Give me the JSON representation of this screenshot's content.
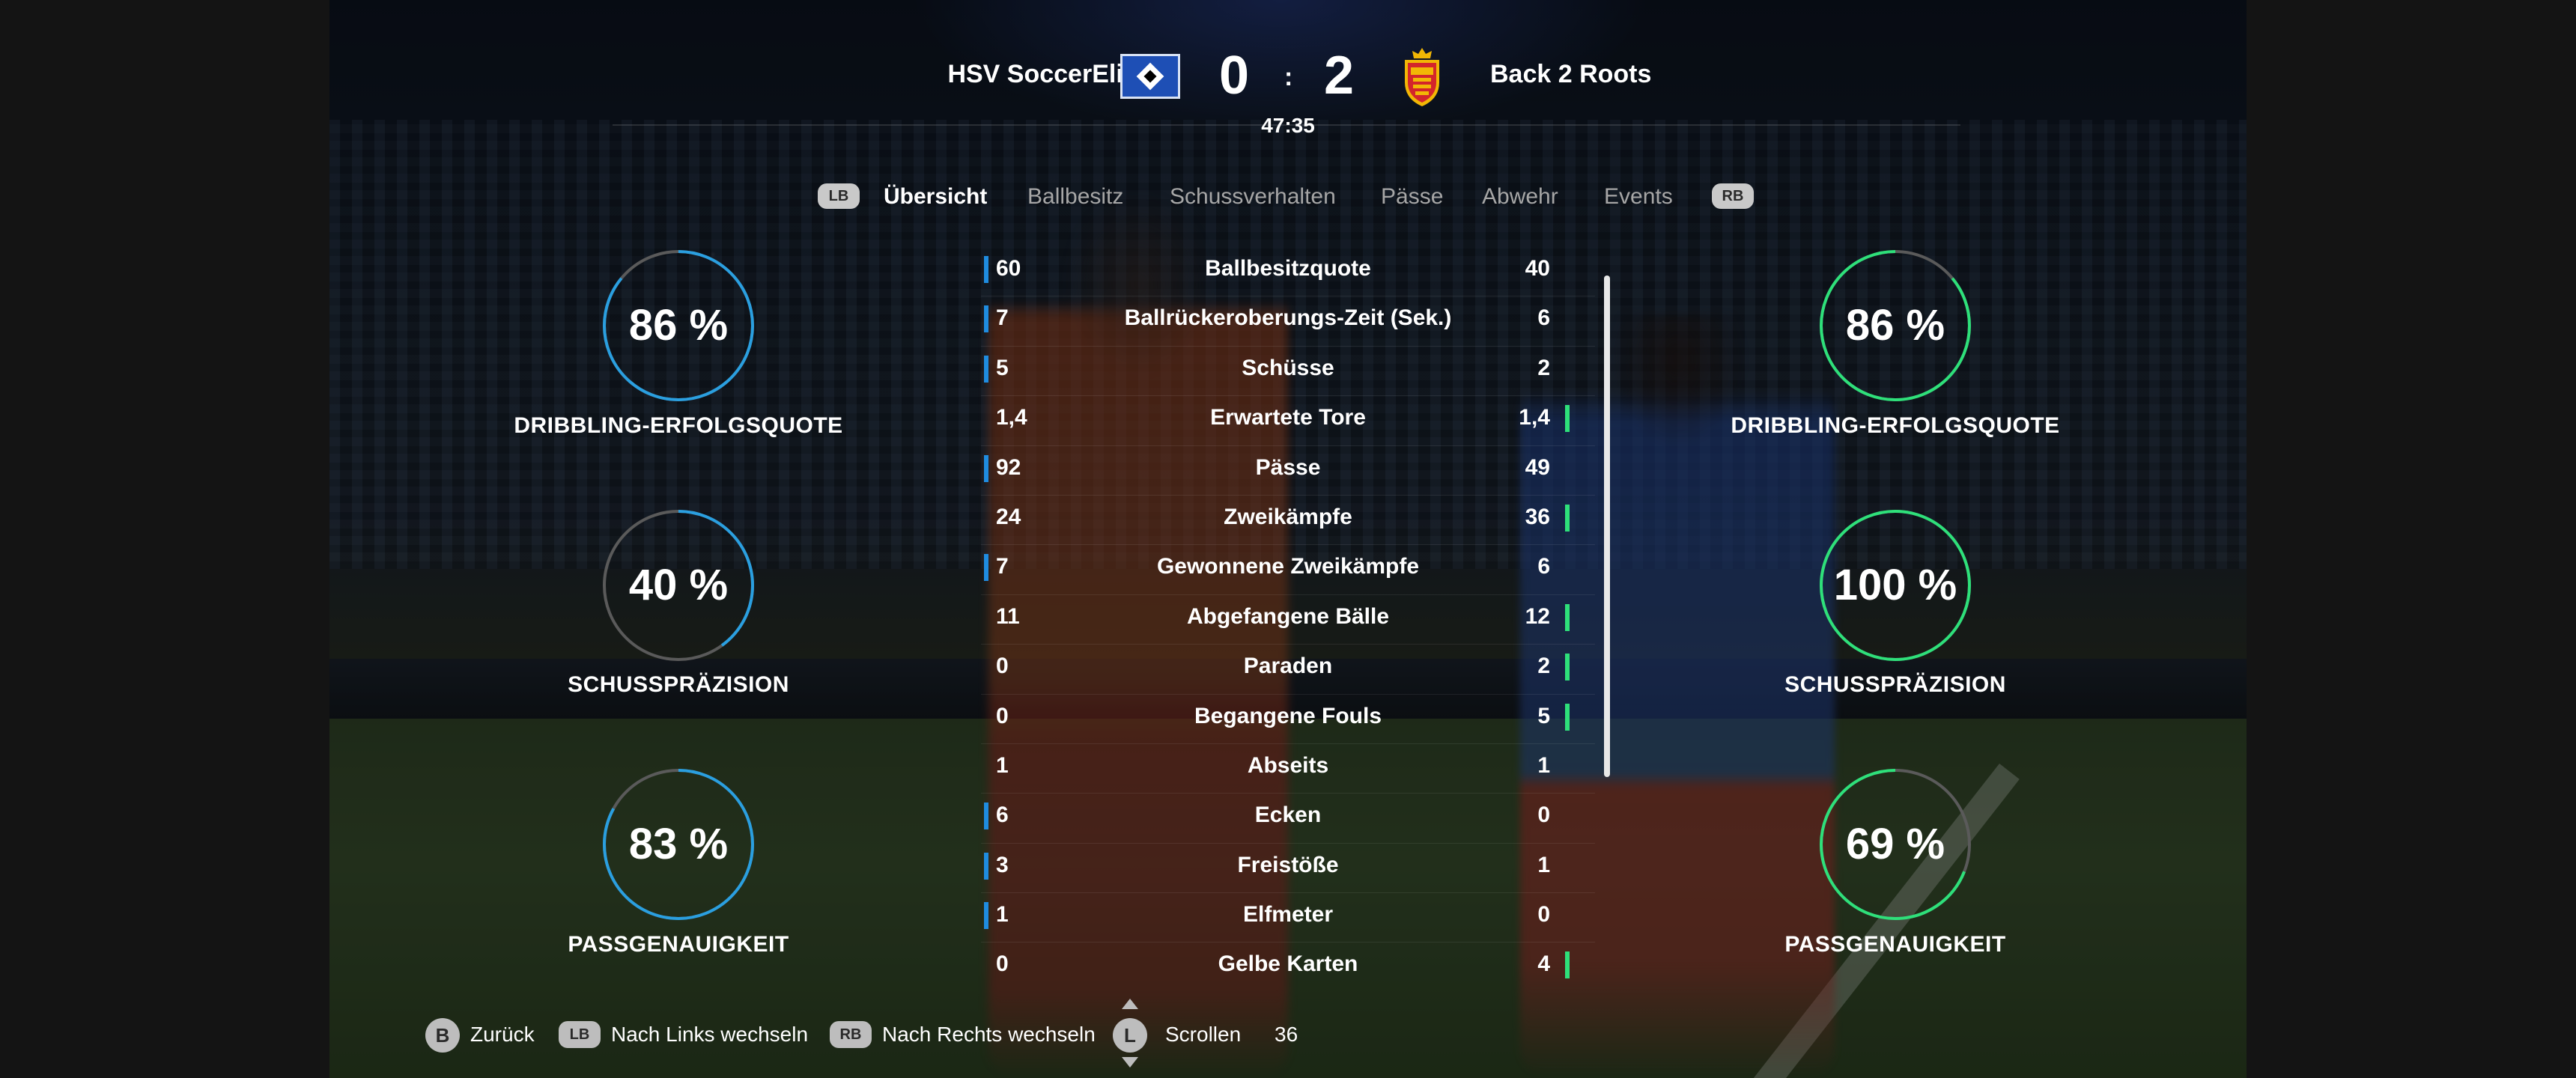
{
  "header": {
    "home_team": "HSV SoccerElite",
    "away_team": "Back 2 Roots",
    "home_score": "0",
    "away_score": "2",
    "separator": ":",
    "clock": "47:35",
    "home_crest_icon": "hsv-diamond-crest-icon",
    "away_crest_icon": "fcn-shield-crest-icon"
  },
  "tabs": {
    "left_bumper": "LB",
    "right_bumper": "RB",
    "items": [
      "Übersicht",
      "Ballbesitz",
      "Schussverhalten",
      "Pässe",
      "Abwehr",
      "Events"
    ],
    "active": "Übersicht"
  },
  "gauges": {
    "home": [
      {
        "value": "86 %",
        "fraction": 0.86,
        "label": "DRIBBLING-ERFOLGSQUOTE"
      },
      {
        "value": "40 %",
        "fraction": 0.4,
        "label": "SCHUSSPRÄZISION"
      },
      {
        "value": "83 %",
        "fraction": 0.83,
        "label": "PASSGENAUIGKEIT"
      }
    ],
    "away": [
      {
        "value": "86 %",
        "fraction": 0.86,
        "label": "DRIBBLING-ERFOLGSQUOTE"
      },
      {
        "value": "100 %",
        "fraction": 1.0,
        "label": "SCHUSSPRÄZISION"
      },
      {
        "value": "69 %",
        "fraction": 0.69,
        "label": "PASSGENAUIGKEIT"
      }
    ],
    "home_color": "#2a9fe0",
    "away_color": "#2ee07a",
    "track_color": "#5a5a5a"
  },
  "stats": [
    {
      "label": "Ballbesitzquote",
      "home": "60",
      "away": "40",
      "lead": "home"
    },
    {
      "label": "Ballrückeroberungs-Zeit (Sek.)",
      "home": "7",
      "away": "6",
      "lead": "home"
    },
    {
      "label": "Schüsse",
      "home": "5",
      "away": "2",
      "lead": "home"
    },
    {
      "label": "Erwartete Tore",
      "home": "1,4",
      "away": "1,4",
      "lead": "away"
    },
    {
      "label": "Pässe",
      "home": "92",
      "away": "49",
      "lead": "home"
    },
    {
      "label": "Zweikämpfe",
      "home": "24",
      "away": "36",
      "lead": "away"
    },
    {
      "label": "Gewonnene Zweikämpfe",
      "home": "7",
      "away": "6",
      "lead": "home"
    },
    {
      "label": "Abgefangene Bälle",
      "home": "11",
      "away": "12",
      "lead": "away"
    },
    {
      "label": "Paraden",
      "home": "0",
      "away": "2",
      "lead": "away"
    },
    {
      "label": "Begangene Fouls",
      "home": "0",
      "away": "5",
      "lead": "away"
    },
    {
      "label": "Abseits",
      "home": "1",
      "away": "1",
      "lead": "none"
    },
    {
      "label": "Ecken",
      "home": "6",
      "away": "0",
      "lead": "home"
    },
    {
      "label": "Freistöße",
      "home": "3",
      "away": "1",
      "lead": "home"
    },
    {
      "label": "Elfmeter",
      "home": "1",
      "away": "0",
      "lead": "home"
    },
    {
      "label": "Gelbe Karten",
      "home": "0",
      "away": "4",
      "lead": "away"
    }
  ],
  "footer": {
    "back_key": "B",
    "back_label": "Zurück",
    "left_key": "LB",
    "left_label": "Nach Links wechseln",
    "right_key": "RB",
    "right_label": "Nach Rechts wechseln",
    "scroll_key": "L",
    "scroll_label": "Scrollen",
    "counter": "36"
  }
}
